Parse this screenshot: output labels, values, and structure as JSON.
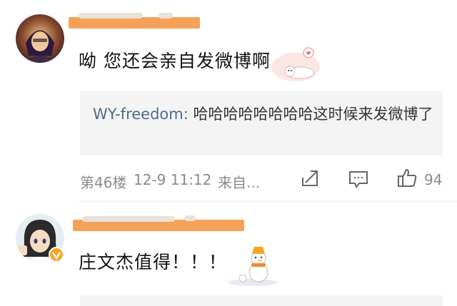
{
  "comments": [
    {
      "text": "呦 您还会亲自发微博啊",
      "quote": {
        "user": "WY-freedom:",
        "text": " 哈哈哈哈哈哈哈哈这时候来发微博了"
      },
      "meta": {
        "floor": "第46楼",
        "time": "12-9 11:12",
        "source": "来自...",
        "likes": "94"
      },
      "sticker": "cat-sticker"
    },
    {
      "text": "庄文杰值得！！！",
      "sticker": "snowman-sticker"
    }
  ],
  "icons": {
    "share": "share-icon",
    "comment": "comment-icon",
    "like": "thumbs-up-icon",
    "verified": "verified-badge-icon"
  },
  "colors": {
    "redaction": "#f6a15a",
    "quote_bg": "#f4f4f4",
    "username_link": "#4d6b8a",
    "verified": "#f5a623"
  }
}
